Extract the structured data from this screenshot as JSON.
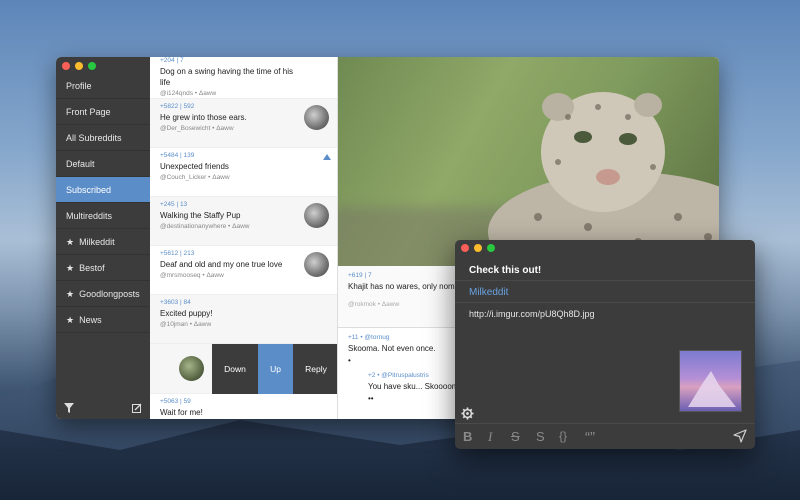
{
  "sidebar": {
    "items": [
      {
        "label": "Profile",
        "star": ""
      },
      {
        "label": "Front Page",
        "star": ""
      },
      {
        "label": "All Subreddits",
        "star": ""
      },
      {
        "label": "Default",
        "star": ""
      },
      {
        "label": "Subscribed",
        "star": "",
        "active": true
      },
      {
        "label": "Multireddits",
        "star": ""
      },
      {
        "label": "Milkeddit",
        "star": "★"
      },
      {
        "label": "Bestof",
        "star": "★"
      },
      {
        "label": "Goodlongposts",
        "star": "★"
      },
      {
        "label": "News",
        "star": "★"
      }
    ]
  },
  "posts": [
    {
      "meta": "+204 | 7",
      "title": "Dog on a swing having the time of his life",
      "author": "@i124qnds • Δaww"
    },
    {
      "meta": "+5822 | 592",
      "title": "He grew into those ears.",
      "author": "@Der_Bosewicht • Δaww"
    },
    {
      "meta": "+5484 | 139",
      "title": "Unexpected friends",
      "author": "@Couch_Licker • Δaww"
    },
    {
      "meta": "+245 | 13",
      "title": "Walking the Staffy Pup",
      "author": "@destinationanywhere • Δaww"
    },
    {
      "meta": "+5612 | 213",
      "title": "Deaf and old and my one true love",
      "author": "@mrsmooseq • Δaww"
    },
    {
      "meta": "+3603 | 84",
      "title": "Excited puppy!",
      "author": "@10jman • Δaww"
    },
    {
      "meta": "+5063 | 59",
      "title": "Wait for me!",
      "author": ""
    }
  ],
  "swipe": {
    "down": "Down",
    "up": "Up",
    "reply": "Reply"
  },
  "comments": [
    {
      "meta": "+619 | 7",
      "text": "Khajit has no wares, only noms",
      "author": "@rokmok • Δaww"
    },
    {
      "meta": "+11 • @tornug",
      "text": "Skooma. Not even once.",
      "extra": "•"
    },
    {
      "meta": "+2 • @Pitruspalustris",
      "text": "You have sku... Skooooma",
      "extra": "••"
    }
  ],
  "compose": {
    "title": "Check this out!",
    "subreddit": "Milkeddit",
    "body": "http://i.imgur.com/pU8Qh8D.jpg",
    "tools": [
      "B",
      "I",
      "S",
      "S",
      "{}",
      "“”"
    ]
  }
}
